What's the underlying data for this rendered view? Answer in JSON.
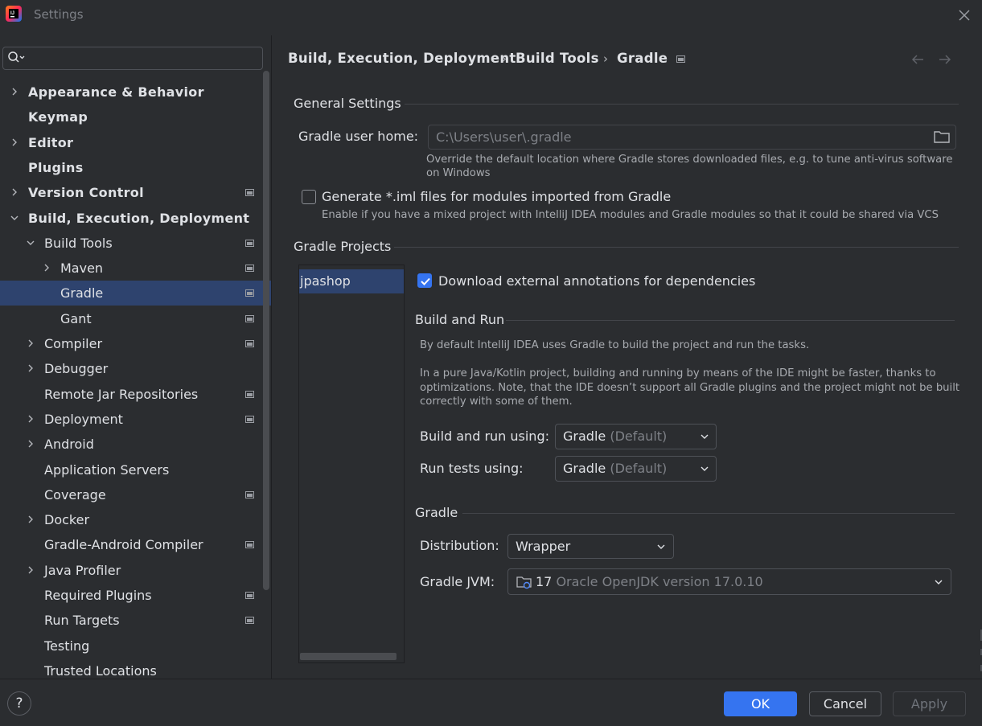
{
  "window": {
    "title": "Settings"
  },
  "search": {
    "placeholder": ""
  },
  "sidebar": {
    "items": [
      {
        "label": "Appearance & Behavior",
        "level": 0,
        "expandable": true,
        "expanded": false,
        "project_icon": false,
        "selected": false
      },
      {
        "label": "Keymap",
        "level": 0,
        "expandable": false,
        "expanded": false,
        "project_icon": false,
        "selected": false
      },
      {
        "label": "Editor",
        "level": 0,
        "expandable": true,
        "expanded": false,
        "project_icon": false,
        "selected": false
      },
      {
        "label": "Plugins",
        "level": 0,
        "expandable": false,
        "expanded": false,
        "project_icon": false,
        "selected": false
      },
      {
        "label": "Version Control",
        "level": 0,
        "expandable": true,
        "expanded": false,
        "project_icon": true,
        "selected": false
      },
      {
        "label": "Build, Execution, Deployment",
        "level": 0,
        "expandable": true,
        "expanded": true,
        "project_icon": false,
        "selected": false
      },
      {
        "label": "Build Tools",
        "level": 1,
        "expandable": true,
        "expanded": true,
        "project_icon": true,
        "selected": false
      },
      {
        "label": "Maven",
        "level": 2,
        "expandable": true,
        "expanded": false,
        "project_icon": true,
        "selected": false
      },
      {
        "label": "Gradle",
        "level": 2,
        "expandable": false,
        "expanded": false,
        "project_icon": true,
        "selected": true
      },
      {
        "label": "Gant",
        "level": 2,
        "expandable": false,
        "expanded": false,
        "project_icon": true,
        "selected": false
      },
      {
        "label": "Compiler",
        "level": 1,
        "expandable": true,
        "expanded": false,
        "project_icon": true,
        "selected": false
      },
      {
        "label": "Debugger",
        "level": 1,
        "expandable": true,
        "expanded": false,
        "project_icon": false,
        "selected": false
      },
      {
        "label": "Remote Jar Repositories",
        "level": 1,
        "expandable": false,
        "expanded": false,
        "project_icon": true,
        "selected": false
      },
      {
        "label": "Deployment",
        "level": 1,
        "expandable": true,
        "expanded": false,
        "project_icon": true,
        "selected": false
      },
      {
        "label": "Android",
        "level": 1,
        "expandable": true,
        "expanded": false,
        "project_icon": false,
        "selected": false
      },
      {
        "label": "Application Servers",
        "level": 1,
        "expandable": false,
        "expanded": false,
        "project_icon": false,
        "selected": false
      },
      {
        "label": "Coverage",
        "level": 1,
        "expandable": false,
        "expanded": false,
        "project_icon": true,
        "selected": false
      },
      {
        "label": "Docker",
        "level": 1,
        "expandable": true,
        "expanded": false,
        "project_icon": false,
        "selected": false
      },
      {
        "label": "Gradle-Android Compiler",
        "level": 1,
        "expandable": false,
        "expanded": false,
        "project_icon": true,
        "selected": false
      },
      {
        "label": "Java Profiler",
        "level": 1,
        "expandable": true,
        "expanded": false,
        "project_icon": false,
        "selected": false
      },
      {
        "label": "Required Plugins",
        "level": 1,
        "expandable": false,
        "expanded": false,
        "project_icon": true,
        "selected": false
      },
      {
        "label": "Run Targets",
        "level": 1,
        "expandable": false,
        "expanded": false,
        "project_icon": true,
        "selected": false
      },
      {
        "label": "Testing",
        "level": 1,
        "expandable": false,
        "expanded": false,
        "project_icon": false,
        "selected": false
      },
      {
        "label": "Trusted Locations",
        "level": 1,
        "expandable": false,
        "expanded": false,
        "project_icon": false,
        "selected": false
      }
    ]
  },
  "breadcrumb": {
    "items": [
      "Build, Execution, Deployment",
      "Build Tools",
      "Gradle"
    ],
    "separator": "›"
  },
  "general": {
    "title": "General Settings",
    "gradle_home_label": "Gradle user home:",
    "gradle_home_value": "C:\\Users\\user\\.gradle",
    "gradle_home_hint_1": "Override the default location where Gradle stores downloaded files, e.g. to tune anti-virus software",
    "gradle_home_hint_2": "on Windows",
    "iml_label": "Generate *.iml files for modules imported from Gradle",
    "iml_checked": false,
    "iml_hint": "Enable if you have a mixed project with IntelliJ IDEA modules and Gradle modules so that it could be shared via VCS"
  },
  "projects": {
    "title": "Gradle Projects",
    "list": [
      "jpashop"
    ],
    "download_annotations_label": "Download external annotations for dependencies",
    "download_annotations_checked": true
  },
  "build_run": {
    "title": "Build and Run",
    "desc_1": "By default IntelliJ IDEA uses Gradle to build the project and run the tasks.",
    "desc_2a": "In a pure Java/Kotlin project, building and running by means of the IDE might be faster, thanks to",
    "desc_2b": "optimizations. Note, that the IDE doesn’t support all Gradle plugins and the project might not be built",
    "desc_2c": "correctly with some of them.",
    "build_using_label": "Build and run using:",
    "build_using_value": "Gradle",
    "build_using_suffix": "(Default)",
    "tests_using_label": "Run tests using:",
    "tests_using_value": "Gradle",
    "tests_using_suffix": "(Default)"
  },
  "gradle": {
    "title": "Gradle",
    "distribution_label": "Distribution:",
    "distribution_value": "Wrapper",
    "jvm_label": "Gradle JVM:",
    "jvm_version": "17",
    "jvm_name": "Oracle OpenJDK version 17.0.10"
  },
  "footer": {
    "help": "?",
    "ok": "OK",
    "cancel": "Cancel",
    "apply": "Apply"
  },
  "colors": {
    "accent": "#3574f0",
    "selection": "#2e436e",
    "background": "#2b2d30"
  }
}
